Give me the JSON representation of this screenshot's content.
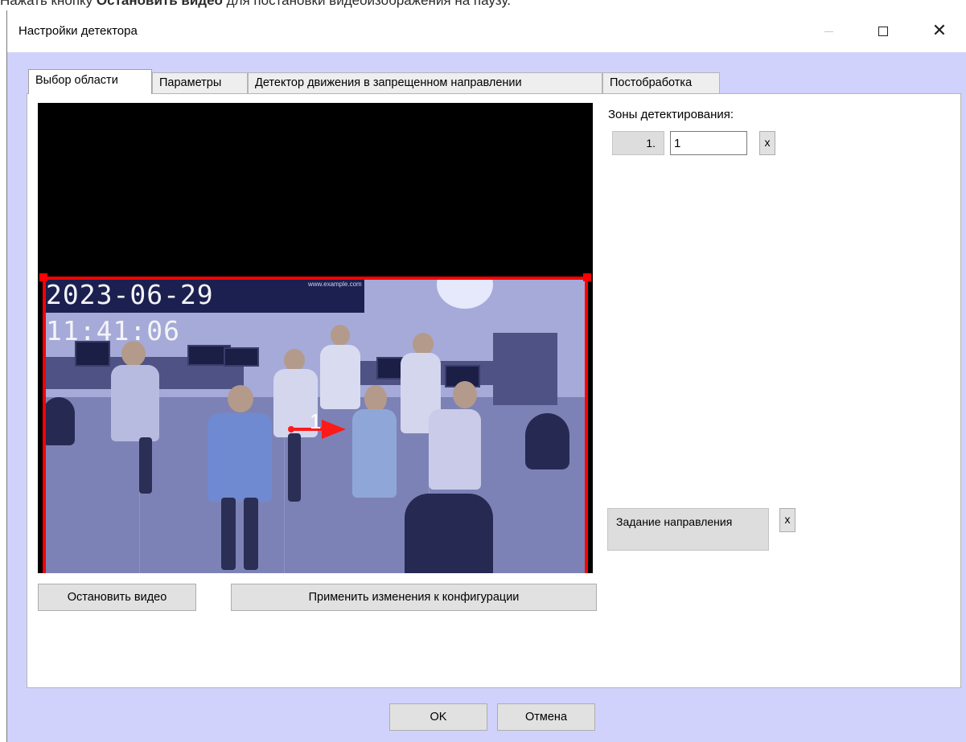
{
  "caption": {
    "before": "Нажать кнопку ",
    "bold": "Остановить видео",
    "after": " для постановки видеоизображения на паузу."
  },
  "window": {
    "title": "Настройки детектора",
    "controls": {
      "minimize": "—",
      "maximize": "□",
      "close": "✕"
    }
  },
  "tabs": [
    {
      "label": "Выбор области",
      "active": true
    },
    {
      "label": "Параметры",
      "active": false
    },
    {
      "label": "Детектор движения в запрещенном направлении",
      "active": false
    },
    {
      "label": "Постобработка",
      "active": false
    }
  ],
  "video": {
    "timestamp": "2023-06-29 11:41:06",
    "watermark": "www.example.com",
    "direction_label": "1",
    "zone_color": "#ff0000"
  },
  "zones": {
    "label": "Зоны детектирования:",
    "items": [
      {
        "number": "1.",
        "name": "1",
        "delete_label": "x"
      }
    ]
  },
  "direction": {
    "button_label": "Задание направления",
    "delete_label": "x"
  },
  "actions": {
    "stop_video": "Остановить видео",
    "apply": "Применить изменения к конфигурации",
    "ok": "OK",
    "cancel": "Отмена"
  },
  "colors": {
    "window_background": "#d0d2fb",
    "video_tint": "#8a8fc4",
    "zone_border": "#ff0000"
  }
}
